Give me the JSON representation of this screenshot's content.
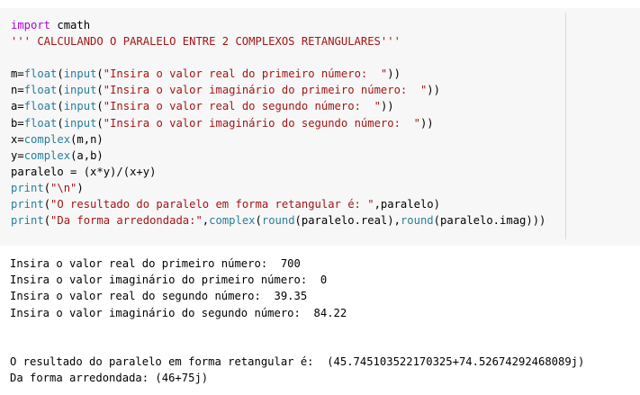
{
  "code_cell": {
    "colors": {
      "keyword": "#af00db",
      "builtin": "#267f99",
      "string": "#a31515",
      "text": "#000000",
      "background": "#f7f7f7"
    },
    "lines": [
      {
        "a": "import",
        "b": " cmath"
      },
      {
        "a": "''' CALCULANDO O PARALELO ENTRE 2 COMPLEXOS RETANGULARES'''"
      },
      {
        "a": ""
      },
      {
        "a": "m=",
        "b": "float",
        "c": "(",
        "d": "input",
        "e": "(",
        "f": "\"Insira o valor real do primeiro número:  \"",
        "g": "))"
      },
      {
        "a": "n=",
        "b": "float",
        "c": "(",
        "d": "input",
        "e": "(",
        "f": "\"Insira o valor imaginário do primeiro número:  \"",
        "g": "))"
      },
      {
        "a": "a=",
        "b": "float",
        "c": "(",
        "d": "input",
        "e": "(",
        "f": "\"Insira o valor real do segundo número:  \"",
        "g": "))"
      },
      {
        "a": "b=",
        "b": "float",
        "c": "(",
        "d": "input",
        "e": "(",
        "f": "\"Insira o valor imaginário do segundo número:  \"",
        "g": "))"
      },
      {
        "a": "x=",
        "b": "complex",
        "c": "(m,n)"
      },
      {
        "a": "y=",
        "b": "complex",
        "c": "(a,b)"
      },
      {
        "a": "paralelo = (x*y)/(x+y)"
      },
      {
        "a": "print",
        "b": "(",
        "c": "\"\\n\"",
        "d": ")"
      },
      {
        "a": "print",
        "b": "(",
        "c": "\"O resultado do paralelo em forma retangular é: \"",
        "d": ",paralelo)"
      },
      {
        "a": "print",
        "b": "(",
        "c": "\"Da forma arredondada:\"",
        "d": ",",
        "e": "complex",
        "f": "(",
        "g": "round",
        "h": "(paralelo.real),",
        "i": "round",
        "j": "(paralelo.imag)))"
      }
    ]
  },
  "output": {
    "lines": [
      "Insira o valor real do primeiro número:  700",
      "Insira o valor imaginário do primeiro número:  0",
      "Insira o valor real do segundo número:  39.35",
      "Insira o valor imaginário do segundo número:  84.22",
      "",
      "",
      "O resultado do paralelo em forma retangular é:  (45.745103522170325+74.52674292468089j)",
      "Da forma arredondada: (46+75j)"
    ]
  }
}
